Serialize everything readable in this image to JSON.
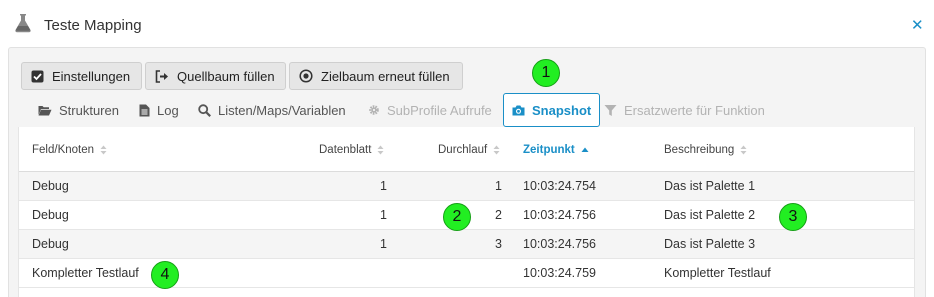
{
  "window": {
    "title": "Teste Mapping",
    "close_icon": "close-icon",
    "title_icon": "flask-icon"
  },
  "toolbar": {
    "buttons": [
      {
        "label": "Einstellungen",
        "icon": "checkbox-icon"
      },
      {
        "label": "Quellbaum füllen",
        "icon": "sign-out-icon"
      },
      {
        "label": "Zielbaum erneut füllen",
        "icon": "dot-circle-icon"
      }
    ]
  },
  "tabs": [
    {
      "label": "Strukturen",
      "icon": "folder-open-icon",
      "state": "normal"
    },
    {
      "label": "Log",
      "icon": "file-icon",
      "state": "normal"
    },
    {
      "label": "Listen/Maps/Variablen",
      "icon": "search-icon",
      "state": "normal"
    },
    {
      "label": "SubProfile Aufrufe",
      "icon": "gear-icon",
      "state": "disabled"
    },
    {
      "label": "Snapshot",
      "icon": "camera-icon",
      "state": "active"
    },
    {
      "label": "Ersatzwerte für Funktion",
      "icon": "filter-icon",
      "state": "disabled"
    }
  ],
  "table": {
    "columns": [
      "Feld/Knoten",
      "Datenblatt",
      "Durchlauf",
      "Zeitpunkt",
      "Beschreibung"
    ],
    "sorted_column": "Zeitpunkt",
    "rows": [
      {
        "feld": "Debug",
        "datenblatt": "1",
        "durchlauf": "1",
        "zeitpunkt": "10:03:24.754",
        "beschreibung": "Das ist Palette 1"
      },
      {
        "feld": "Debug",
        "datenblatt": "1",
        "durchlauf": "2",
        "zeitpunkt": "10:03:24.756",
        "beschreibung": "Das ist Palette 2"
      },
      {
        "feld": "Debug",
        "datenblatt": "1",
        "durchlauf": "3",
        "zeitpunkt": "10:03:24.756",
        "beschreibung": "Das ist Palette 3"
      },
      {
        "feld": "Kompletter Testlauf",
        "datenblatt": "",
        "durchlauf": "",
        "zeitpunkt": "10:03:24.759",
        "beschreibung": "Kompletter Testlauf"
      }
    ]
  },
  "markers": [
    "1",
    "2",
    "3",
    "4"
  ],
  "colors": {
    "accent": "#1a8fc7",
    "marker": "#22ee22",
    "disabled": "#b3b3b3"
  }
}
